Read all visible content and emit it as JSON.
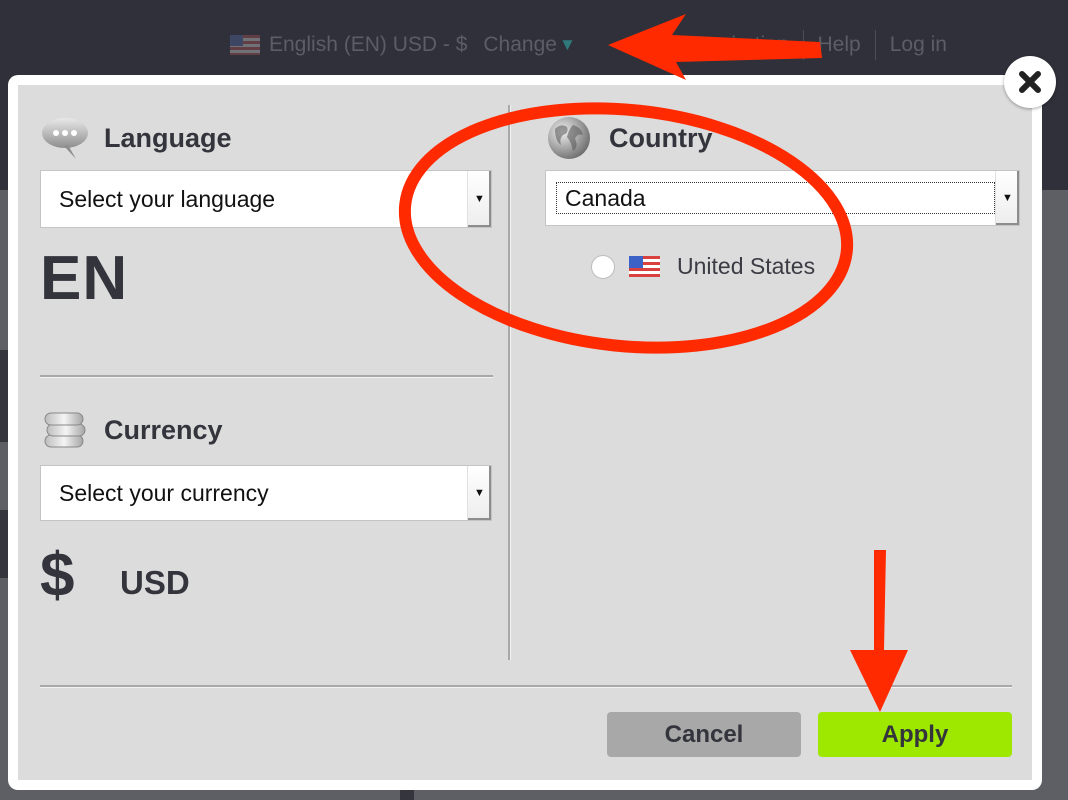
{
  "topbar": {
    "locale_summary": "English (EN) USD - $",
    "change_label": "Change",
    "change_caret": "▼",
    "nav_items": [
      "& Inspiration",
      "Help",
      "Log in"
    ]
  },
  "modal": {
    "close_icon": "close-icon",
    "language": {
      "heading": "Language",
      "icon": "speech-bubble-icon",
      "select_placeholder": "Select your language",
      "current_code": "EN"
    },
    "currency": {
      "heading": "Currency",
      "icon": "coins-icon",
      "select_placeholder": "Select your currency",
      "symbol": "$",
      "current_code": "USD"
    },
    "country": {
      "heading": "Country",
      "icon": "globe-icon",
      "selected": "Canada",
      "options": [
        {
          "label": "United States",
          "flag": "us-flag-icon",
          "checked": false
        }
      ]
    },
    "buttons": {
      "cancel": "Cancel",
      "apply": "Apply"
    }
  },
  "colors": {
    "apply": "#9ee800",
    "cancel": "#a8a8a8",
    "annotation": "#ff2a00",
    "topbar": "#2f3039"
  }
}
